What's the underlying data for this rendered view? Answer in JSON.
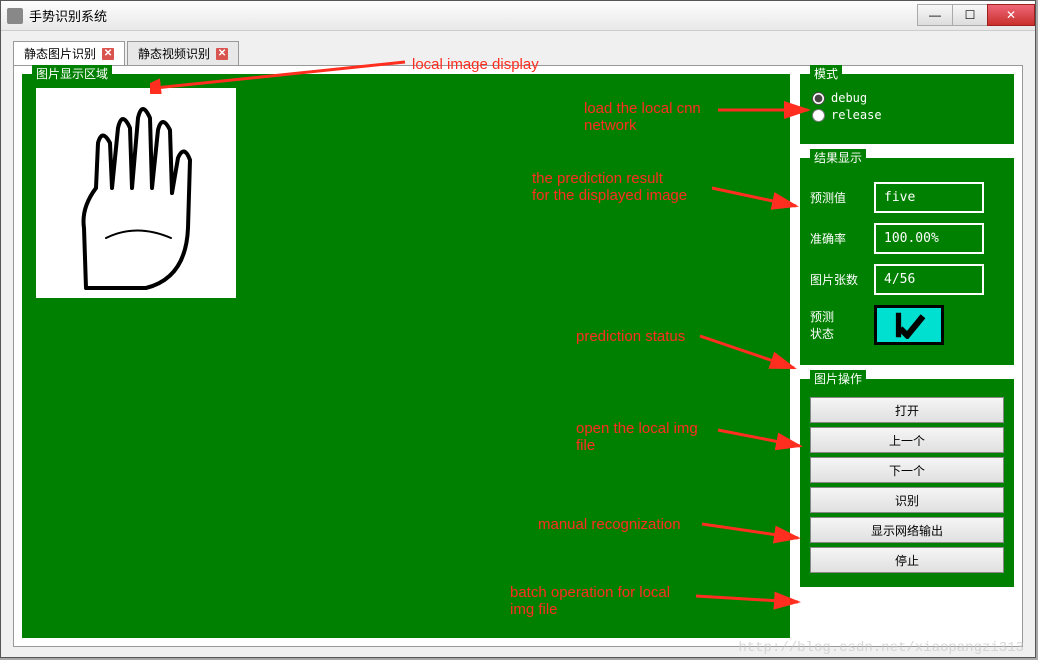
{
  "window": {
    "title": "手势识别系统"
  },
  "tabs": [
    {
      "label": "静态图片识别",
      "active": true
    },
    {
      "label": "静态视频识别",
      "active": false
    }
  ],
  "image_area": {
    "legend": "图片显示区域"
  },
  "mode": {
    "legend": "模式",
    "options": {
      "debug": "debug",
      "release": "release"
    },
    "selected": "debug"
  },
  "results": {
    "legend": "结果显示",
    "predicted_label": "预测值",
    "predicted_value": "five",
    "accuracy_label": "准确率",
    "accuracy_value": "100.00%",
    "count_label": "图片张数",
    "count_value": "4/56",
    "status_label_line1": "预测",
    "status_label_line2": "状态"
  },
  "ops": {
    "legend": "图片操作",
    "buttons": {
      "open": "打开",
      "prev": "上一个",
      "next": "下一个",
      "recognize": "识别",
      "show_output": "显示网络输出",
      "stop": "停止"
    }
  },
  "annotations": {
    "img_display": "local image display",
    "load_cnn_line1": "load the local cnn",
    "load_cnn_line2": "network",
    "pred_result_line1": "the prediction result",
    "pred_result_line2": "for the displayed image",
    "pred_status": "prediction status",
    "open_img_line1": "open the local img",
    "open_img_line2": "file",
    "manual": "manual recognization",
    "batch_line1": "batch operation for local",
    "batch_line2": "img  file"
  },
  "watermark": "http://blog.csdn.net/xiaopangzi313",
  "icons": {
    "checkmark": "checkmark-icon"
  }
}
